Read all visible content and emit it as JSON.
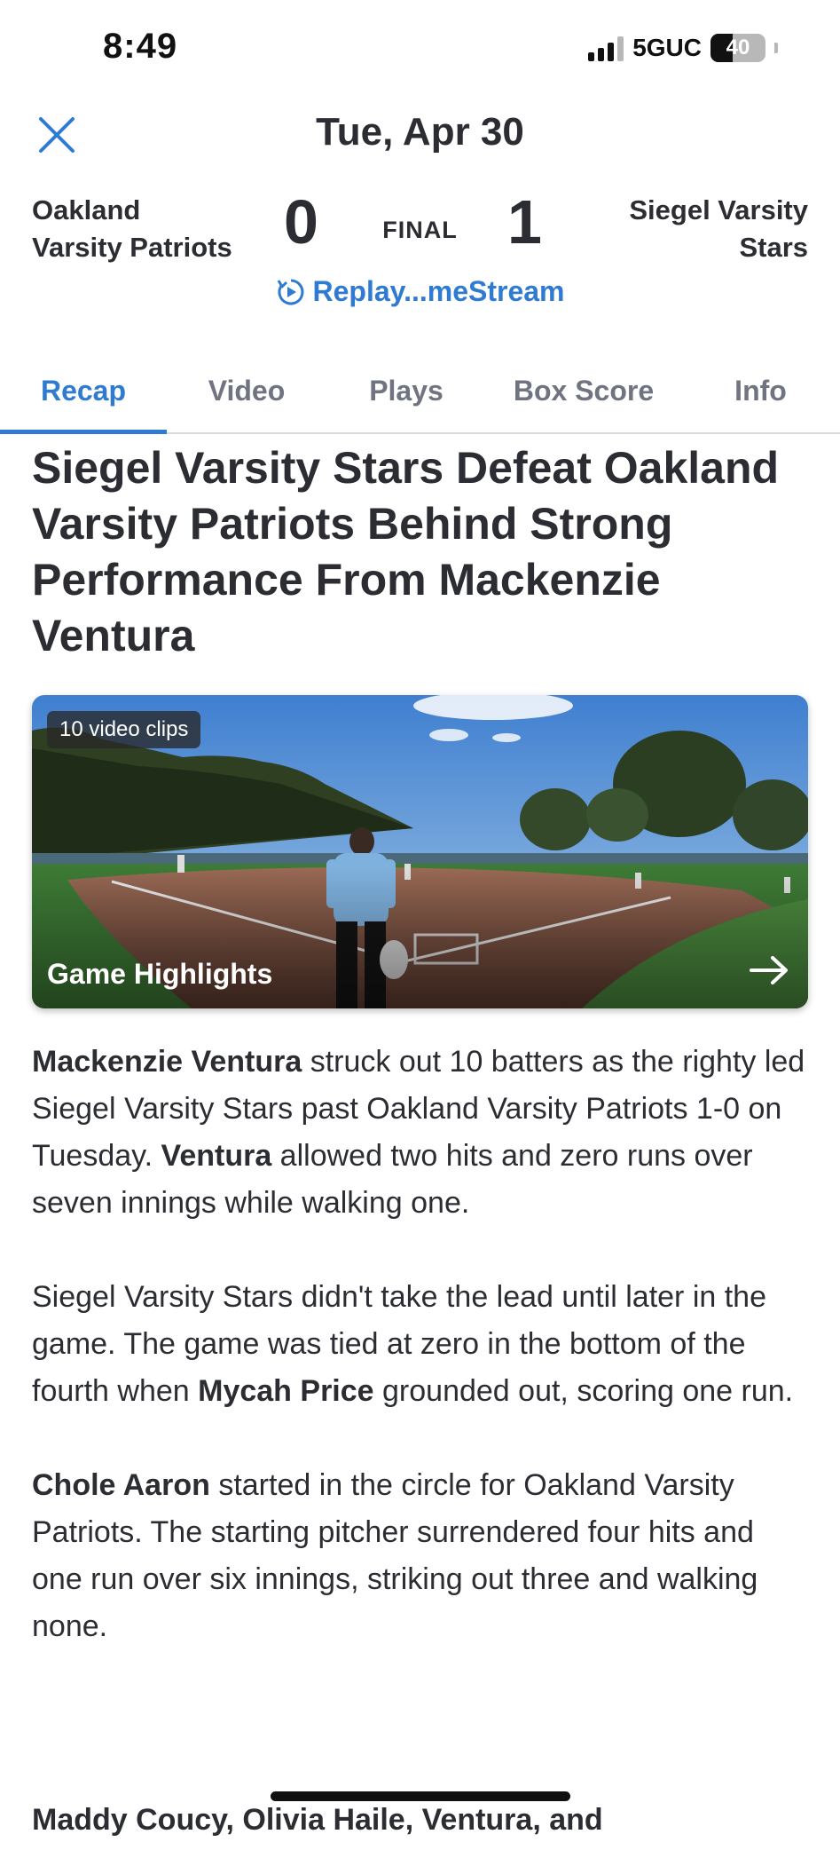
{
  "status": {
    "time": "8:49",
    "network": "5GUC",
    "battery": "40",
    "battery_level": 0.4
  },
  "header": {
    "date": "Tue, Apr 30",
    "home_team_line1": "Oakland",
    "home_team_line2": "Varsity Patriots",
    "away_team_line1": "Siegel Varsity",
    "away_team_line2": "Stars",
    "home_score": "0",
    "away_score": "1",
    "status": "FINAL",
    "replay_label": "Replay...meStream"
  },
  "tabs": [
    "Recap",
    "Video",
    "Plays",
    "Box Score",
    "Info"
  ],
  "headline": "Siegel Varsity Stars Defeat Oakland Varsity Patriots Behind Strong Performance From Mackenzie Ventura",
  "video": {
    "clips_badge": "10 video clips",
    "title": "Game Highlights"
  },
  "article": {
    "p1": [
      {
        "b": "Mackenzie Ventura"
      },
      {
        "t": " struck out 10 batters as the righty led Siegel Varsity Stars past Oakland Varsity Patriots 1-0 on Tuesday. "
      },
      {
        "b": "Ventura"
      },
      {
        "t": " allowed two hits and zero runs over seven innings while walking one."
      }
    ],
    "p2": [
      {
        "t": "Siegel Varsity Stars didn't take the lead until later in the game. The game was tied at zero in the bottom of the fourth when "
      },
      {
        "b": "Mycah Price"
      },
      {
        "t": " grounded out, scoring one run."
      }
    ],
    "p3": [
      {
        "b": "Chole Aaron"
      },
      {
        "t": " started in the circle for Oakland Varsity Patriots. The starting pitcher surrendered four hits and one run over six innings, striking out three and walking none."
      }
    ],
    "cutoff": "Maddy Coucy, Olivia Haile, Ventura, and"
  },
  "colors": {
    "accent": "#2e7bd1",
    "text": "#2b2d33",
    "muted": "#6f7480"
  }
}
